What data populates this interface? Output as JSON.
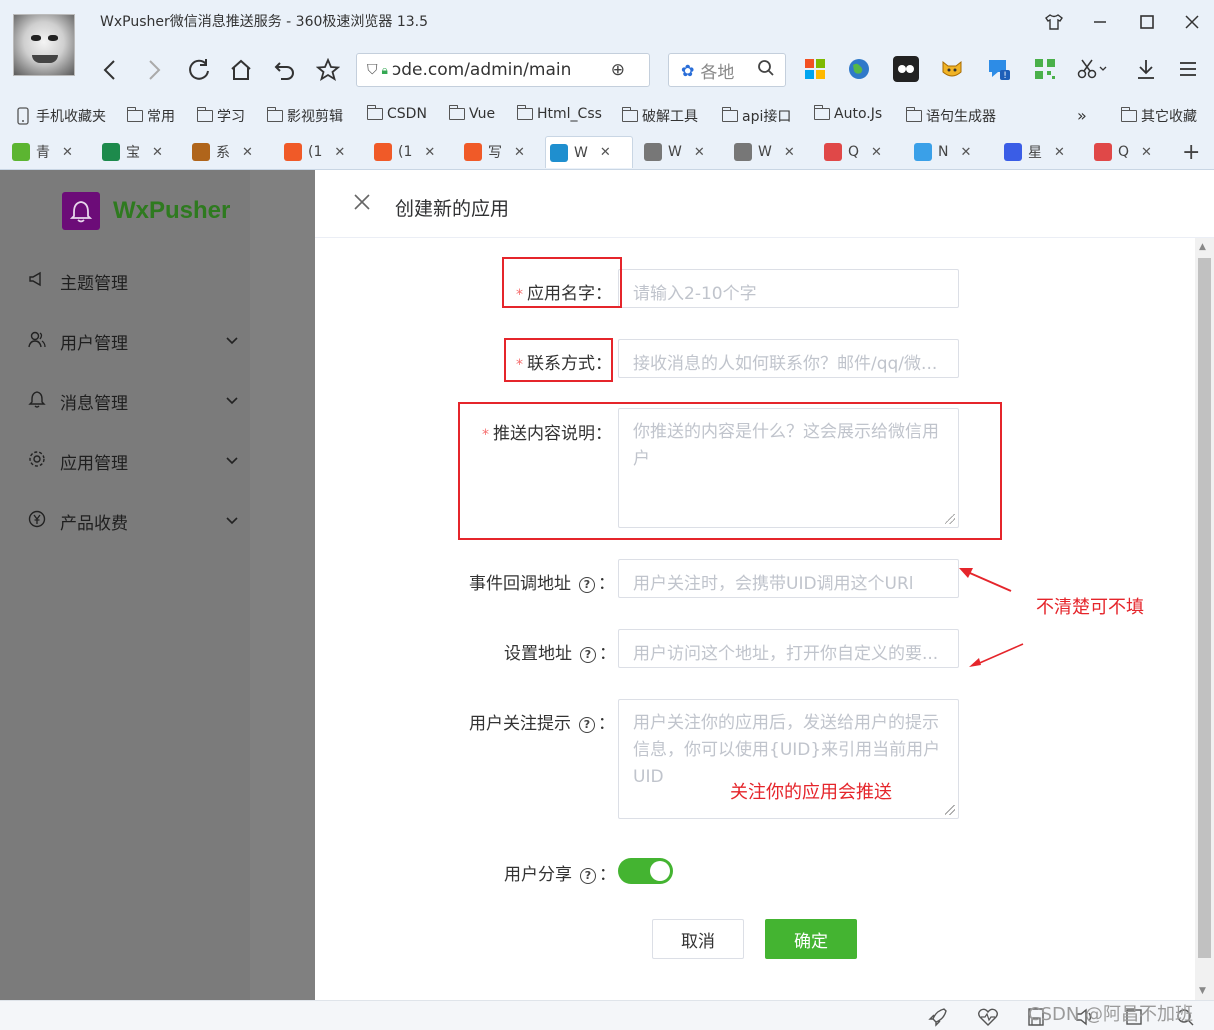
{
  "browser": {
    "window_title": "WxPusher微信消息推送服务 - 360极速浏览器 13.5",
    "address": {
      "url_visible": "ɔde.com/admin/main"
    },
    "search": {
      "text": "各地"
    },
    "bookmarks": [
      "手机收藏夹",
      "常用",
      "学习",
      "影视剪辑",
      "CSDN",
      "Vue",
      "Html_Css",
      "破解工具",
      "api接口",
      "Auto.Js",
      "语句生成器",
      "»",
      "其它收藏"
    ],
    "tabs": [
      {
        "label": "青",
        "icon": "lime-icon",
        "color": "#5cb531"
      },
      {
        "label": "宝",
        "icon": "shield-icon",
        "color": "#1d8a4c"
      },
      {
        "label": "系",
        "icon": "bull-icon",
        "color": "#b0651b"
      },
      {
        "label": "(1",
        "icon": "csdn-icon",
        "color": "#f05a28"
      },
      {
        "label": "(1",
        "icon": "csdn-icon",
        "color": "#f05a28"
      },
      {
        "label": "写",
        "icon": "csdn-icon",
        "color": "#f05a28"
      },
      {
        "label": "W",
        "icon": "react-icon",
        "color": "#1f8fcf",
        "active": true
      },
      {
        "label": "W",
        "icon": "page-icon",
        "color": "#777777"
      },
      {
        "label": "W",
        "icon": "page-icon",
        "color": "#777777"
      },
      {
        "label": "Q",
        "icon": "swirl-icon",
        "color": "#e04848"
      },
      {
        "label": "N",
        "icon": "cloud-icon",
        "color": "#3aa0e8"
      },
      {
        "label": "星",
        "icon": "u-icon",
        "color": "#3a5de6"
      },
      {
        "label": "Q",
        "icon": "swirl-icon",
        "color": "#e04848"
      }
    ]
  },
  "app": {
    "brand": "WxPusher",
    "menu": [
      {
        "label": "主题管理",
        "icon": "megaphone-icon",
        "expandable": false
      },
      {
        "label": "用户管理",
        "icon": "users-icon",
        "expandable": true
      },
      {
        "label": "消息管理",
        "icon": "bell-icon",
        "expandable": true
      },
      {
        "label": "应用管理",
        "icon": "gear-icon",
        "expandable": true
      },
      {
        "label": "产品收费",
        "icon": "yen-icon",
        "expandable": true
      }
    ]
  },
  "dialog": {
    "title": "创建新的应用",
    "fields": {
      "app_name": {
        "label": "应用名字",
        "required": true,
        "placeholder": "请输入2-10个字"
      },
      "contact": {
        "label": "联系方式",
        "required": true,
        "placeholder": "接收消息的人如何联系你？邮件/qq/微..."
      },
      "description": {
        "label": "推送内容说明",
        "required": true,
        "placeholder": "你推送的内容是什么？这会展示给微信用户"
      },
      "callback_url": {
        "label": "事件回调地址",
        "placeholder": "用户关注时，会携带UID调用这个URl"
      },
      "settings_url": {
        "label": "设置地址",
        "placeholder": "用户访问这个地址，打开你自定义的要..."
      },
      "follow_tip": {
        "label": "用户关注提示",
        "placeholder": "用户关注你的应用后，发送给用户的提示信息，你可以使用{UID}来引用当前用户UID"
      },
      "share": {
        "label": "用户分享",
        "enabled": true
      }
    },
    "colon": "：",
    "help_glyph": "?",
    "required_mark": "*",
    "buttons": {
      "cancel": "取消",
      "ok": "确定"
    },
    "annotations": {
      "optional_note": "不清楚可不填",
      "follow_note": "关注你的应用会推送"
    }
  },
  "watermark": "CSDN @阿昌不加班",
  "colors": {
    "accent_green": "#44b431",
    "brand_purple": "#6c0c78",
    "annotation_red": "#e5252b",
    "required_red": "#f56c6c"
  }
}
